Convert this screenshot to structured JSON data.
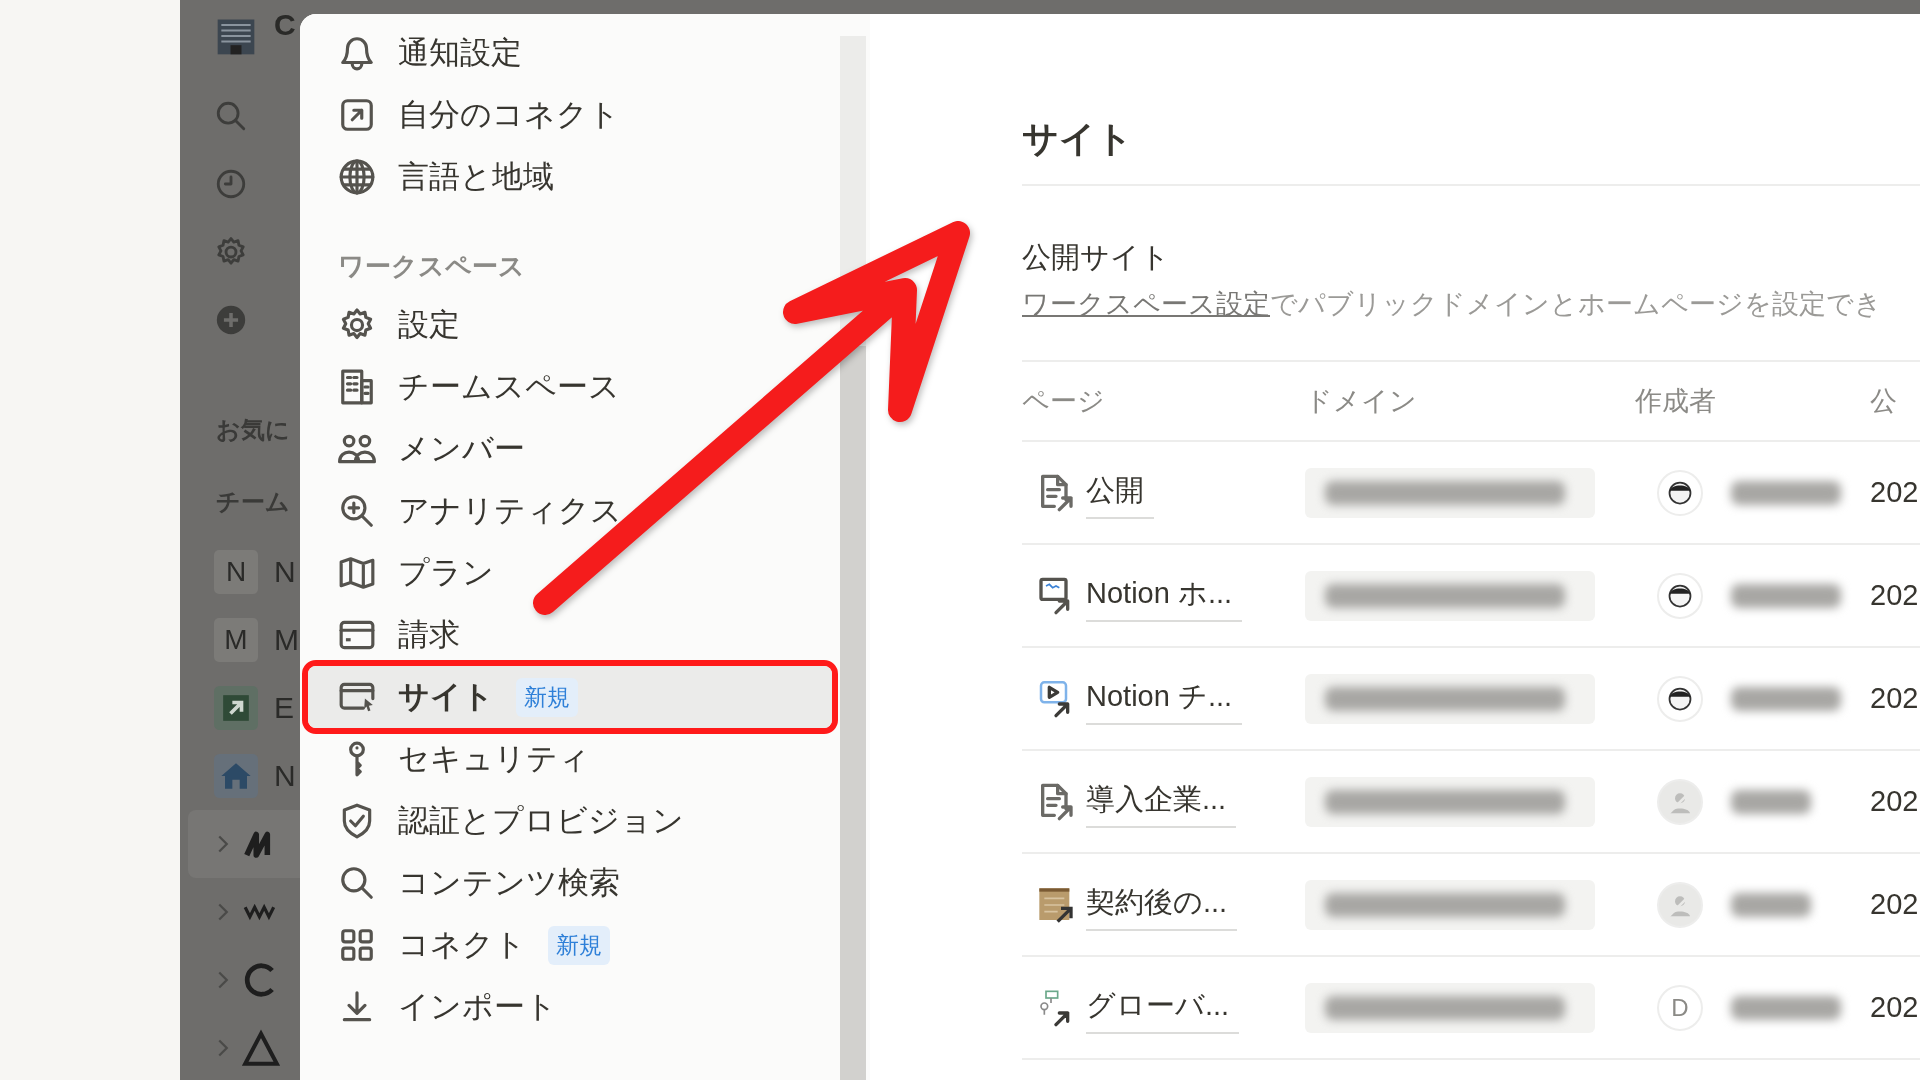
{
  "background_sidebar": {
    "workspace_initial": "C",
    "nav": [
      {
        "kind": "search"
      },
      {
        "kind": "clock"
      },
      {
        "kind": "gear"
      },
      {
        "kind": "plus"
      }
    ],
    "sections": [
      "お気に",
      "チーム"
    ],
    "teamspaces": [
      {
        "kind": "letter",
        "badge": "N",
        "name": "N"
      },
      {
        "kind": "letter",
        "badge": "M",
        "name": "M"
      },
      {
        "kind": "arrow",
        "name": "E"
      },
      {
        "kind": "home",
        "name": "N"
      }
    ],
    "pages": [
      {
        "kind": "zigzag",
        "selected": true
      },
      {
        "kind": "wave",
        "selected": false
      },
      {
        "kind": "ring",
        "selected": false
      },
      {
        "kind": "triangle",
        "selected": false
      }
    ]
  },
  "settings_nav": {
    "account_items": [
      {
        "kind": "bell",
        "label": "通知設定",
        "selected": false
      },
      {
        "kind": "connect",
        "label": "自分のコネクト",
        "selected": false
      },
      {
        "kind": "globe",
        "label": "言語と地域",
        "selected": false
      }
    ],
    "workspace_heading": "ワークスペース",
    "workspace_items": [
      {
        "kind": "gear",
        "label": "設定",
        "selected": false
      },
      {
        "kind": "building",
        "label": "チームスペース",
        "selected": false
      },
      {
        "kind": "people",
        "label": "メンバー",
        "selected": false
      },
      {
        "kind": "zoom",
        "label": "アナリティクス",
        "selected": false
      },
      {
        "kind": "map",
        "label": "プラン",
        "selected": false
      },
      {
        "kind": "card",
        "label": "請求",
        "selected": false
      },
      {
        "kind": "browser",
        "label": "サイト",
        "selected": true,
        "badge": "新規",
        "highlighted": true
      },
      {
        "kind": "key",
        "label": "セキュリティ",
        "selected": false
      },
      {
        "kind": "shield",
        "label": "認証とプロビジョン",
        "selected": false
      },
      {
        "kind": "search",
        "label": "コンテンツ検索",
        "selected": false
      },
      {
        "kind": "grid",
        "label": "コネクト",
        "selected": false,
        "badge": "新規"
      },
      {
        "kind": "import",
        "label": "インポート",
        "selected": false
      }
    ]
  },
  "content": {
    "title": "サイト",
    "section_title": "公開サイト",
    "description": {
      "link": "ワークスペース設定",
      "text": "でパブリックドメインとホームページを設定でき"
    },
    "table": {
      "columns": [
        "ページ",
        "ドメイン",
        "作成者",
        "公"
      ],
      "rows": [
        {
          "kind": "doc",
          "title": "公開",
          "author": {
            "kind": "face"
          },
          "date": "202"
        },
        {
          "kind": "whiteboard",
          "title": "Notion ホ...",
          "author": {
            "kind": "face"
          },
          "date": "202"
        },
        {
          "kind": "video",
          "title": "Notion チ...",
          "author": {
            "kind": "face"
          },
          "date": "202"
        },
        {
          "kind": "doc",
          "title": "導入企業...",
          "author": {
            "kind": "blank"
          },
          "date": "202"
        },
        {
          "kind": "scroll",
          "title": "契約後の...",
          "author": {
            "kind": "blank"
          },
          "date": "202"
        },
        {
          "kind": "diagram",
          "title": "グローバ...",
          "author": {
            "kind": "letter",
            "letter": "D"
          },
          "date": "202"
        }
      ]
    }
  },
  "annotation_arrow": true
}
